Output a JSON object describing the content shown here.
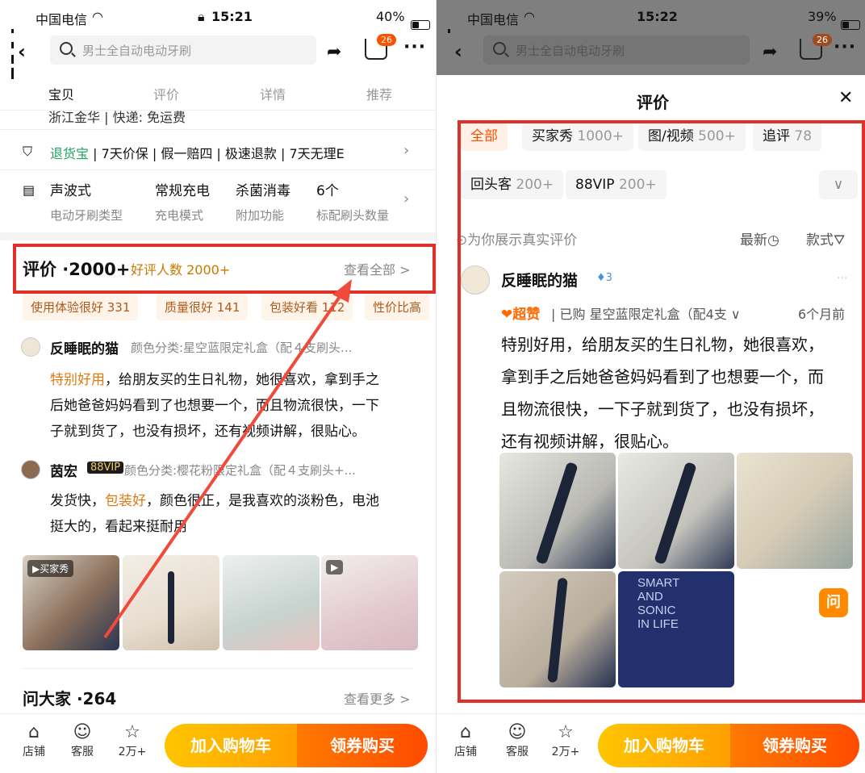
{
  "left": {
    "status": {
      "carrier": "中国电信",
      "time": "15:21",
      "battery": "40%"
    },
    "search_placeholder": "男士全自动电动牙刷",
    "cart_badge": "26",
    "tabs": [
      "宝贝",
      "评价",
      "详情",
      "推荐"
    ],
    "shipping_cut": "浙江金华 | 快递: 免运费",
    "guarantee": {
      "brand": "退货宝",
      "items": "| 7天价保 | 假一赔四 | 极速退款 | 7天无理E"
    },
    "specs": [
      {
        "value": "声波式",
        "label": "电动牙刷类型"
      },
      {
        "value": "常规充电",
        "label": "充电模式"
      },
      {
        "value": "杀菌消毒",
        "label": "附加功能"
      },
      {
        "value": "6个",
        "label": "标配刷头数量"
      }
    ],
    "reviews_header": {
      "title": "评价 ·2000+",
      "positive": "好评人数 2000+",
      "see_all": "查看全部 >"
    },
    "review_tags": [
      "使用体验很好 331",
      "质量很好 141",
      "包装好看 112",
      "性价比高"
    ],
    "review1": {
      "user": "反睡眠的猫",
      "variant": "颜色分类:星空蓝限定礼盒（配４支刷头...",
      "highlight": "特别好用",
      "lines": [
        "，给朋友买的生日礼物，她很喜欢，拿到手之",
        "后她爸爸妈妈看到了也想要一个，而且物流很快，一下",
        "子就到货了，也没有损坏，还有视频讲解，很贴心。"
      ]
    },
    "review2": {
      "user": "茵宏",
      "vip": "88VIP",
      "variant": "颜色分类:樱花粉限定礼盒（配４支刷头+...",
      "line1_a": "发货快，",
      "line1_hl": "包装好",
      "line1_b": "，颜色很正，是我喜欢的淡粉色，电池",
      "line2": "挺大的，看起来挺耐用"
    },
    "photo_badge": "▶买家秀",
    "ask": {
      "title": "问大家 ·264",
      "more": "查看更多 >"
    },
    "bottom": {
      "shop": "店铺",
      "service": "客服",
      "fav": "2万+",
      "add_cart": "加入购物车",
      "buy": "领券购买"
    }
  },
  "right": {
    "status": {
      "carrier": "中国电信",
      "time": "15:22",
      "battery": "39%"
    },
    "search_placeholder": "男士全自动电动牙刷",
    "cart_badge": "26",
    "sheet_title": "评价",
    "filters_row1": [
      {
        "label": "全部",
        "count": ""
      },
      {
        "label": "买家秀",
        "count": "1000+"
      },
      {
        "label": "图/视频",
        "count": "500+"
      },
      {
        "label": "追评",
        "count": "78"
      }
    ],
    "filters_row2": [
      {
        "label": "回头客",
        "count": "200+"
      },
      {
        "label": "88VIP",
        "count": "200+"
      }
    ],
    "real_review": "为你展示真实评价",
    "sort": "最新",
    "style": "款式",
    "review": {
      "user": "反睡眠的猫",
      "level": "3",
      "super": "超赞",
      "bought": "| 已购 星空蓝限定礼盒（配4支 ∨",
      "time": "6个月前",
      "lines": [
        "特别好用，给朋友买的生日礼物，她很喜欢，",
        "拿到手之后她爸爸妈妈看到了也想要一个，而",
        "且物流很快，一下子就到货了，也没有损坏，",
        "还有视频讲解，很贴心。"
      ]
    },
    "book_text": "SMART\nAND\nSONIC\nIN LIFE",
    "ask_badge": "问",
    "bottom": {
      "shop": "店铺",
      "service": "客服",
      "fav": "2万+",
      "add_cart": "加入购物车",
      "buy": "领券购买"
    }
  }
}
